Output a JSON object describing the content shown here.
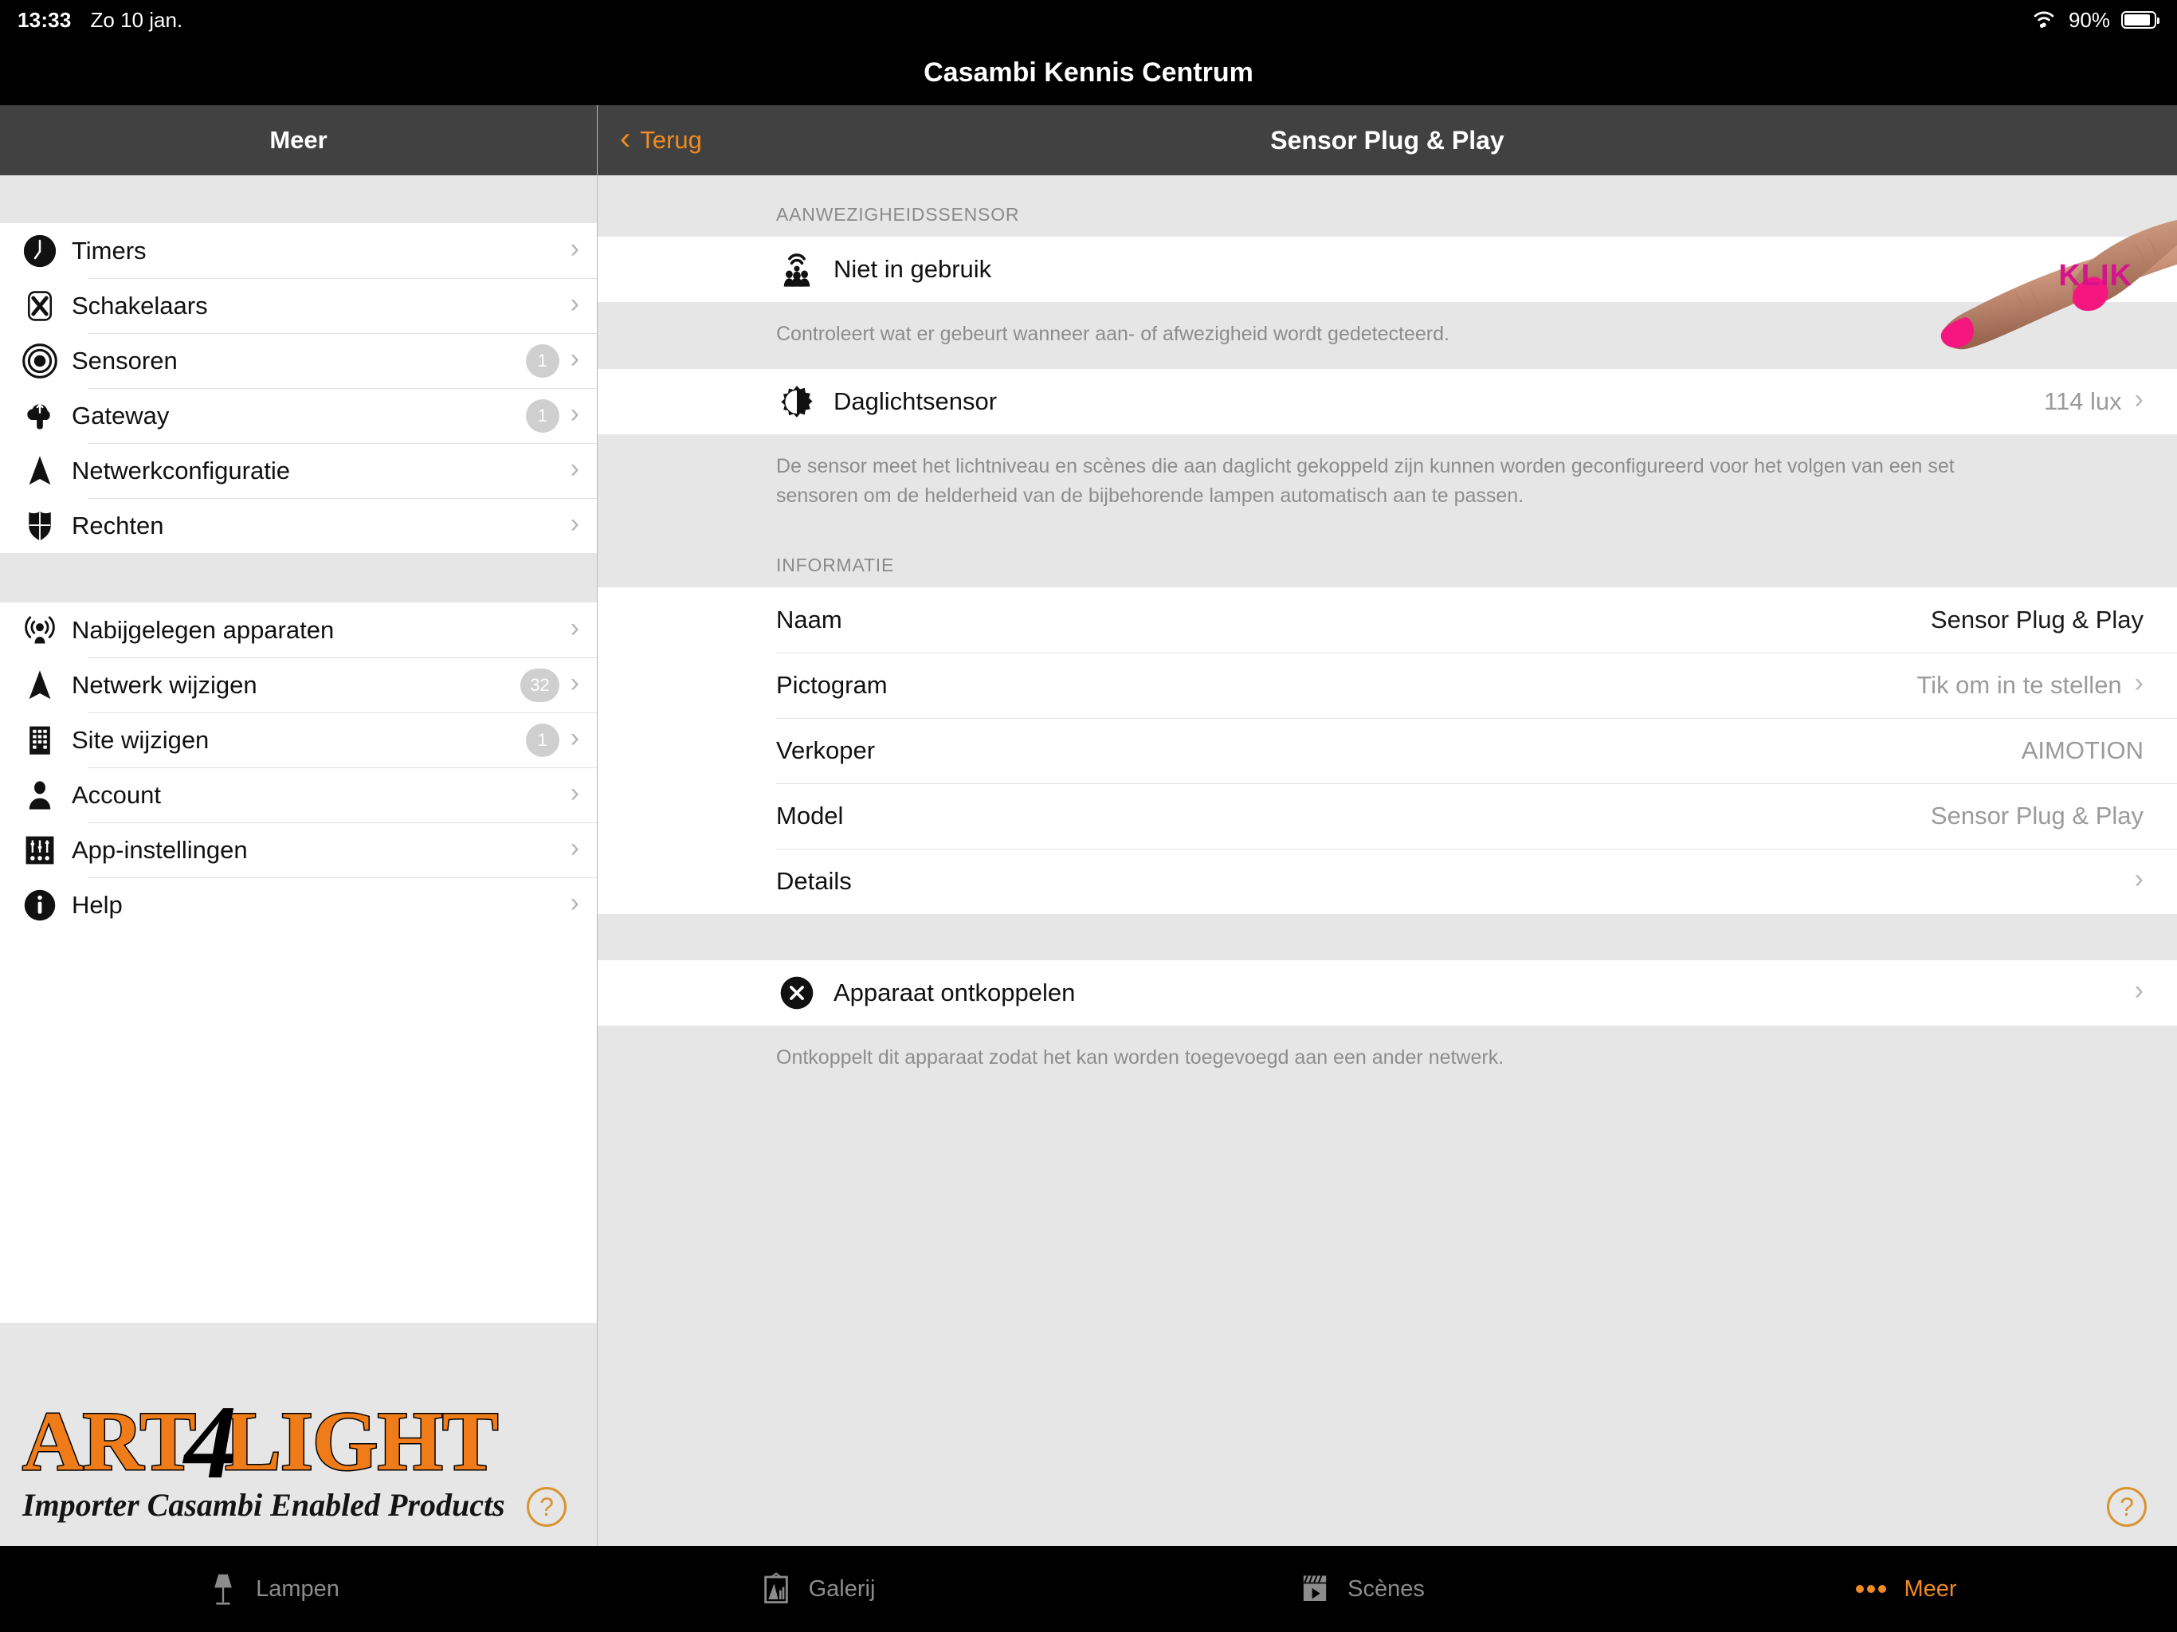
{
  "status_bar": {
    "time": "13:33",
    "date": "Zo 10 jan.",
    "battery_percent": "90%",
    "wifi_icon": "wifi-icon",
    "battery_icon": "battery-icon"
  },
  "app_title": "Casambi Kennis Centrum",
  "left_pane": {
    "navbar_title": "Meer",
    "group1": [
      {
        "label": "Timers",
        "icon": "clock-icon",
        "badge": null
      },
      {
        "label": "Schakelaars",
        "icon": "switch-icon",
        "badge": null
      },
      {
        "label": "Sensoren",
        "icon": "sensor-icon",
        "badge": "1"
      },
      {
        "label": "Gateway",
        "icon": "gateway-cloud-icon",
        "badge": "1"
      },
      {
        "label": "Netwerkconfiguratie",
        "icon": "network-icon",
        "badge": null
      },
      {
        "label": "Rechten",
        "icon": "shield-icon",
        "badge": null
      }
    ],
    "group2": [
      {
        "label": "Nabijgelegen apparaten",
        "icon": "nearby-devices-icon",
        "badge": null
      },
      {
        "label": "Netwerk wijzigen",
        "icon": "network-icon",
        "badge": "32"
      },
      {
        "label": "Site wijzigen",
        "icon": "building-icon",
        "badge": "1"
      },
      {
        "label": "Account",
        "icon": "person-icon",
        "badge": null
      },
      {
        "label": "App-instellingen",
        "icon": "sliders-icon",
        "badge": null
      },
      {
        "label": "Help",
        "icon": "info-icon",
        "badge": null
      }
    ],
    "help_button": "?"
  },
  "right_pane": {
    "back_label": "Terug",
    "back_icon": "chevron-left-icon",
    "navbar_title": "Sensor Plug & Play",
    "section_presence": {
      "header": "AANWEZIGHEIDSSENSOR",
      "row": {
        "label": "Niet in gebruik",
        "icon": "presence-sensor-icon"
      },
      "description": "Controleert wat er gebeurt wanneer aan- of afwezigheid wordt gedetecteerd."
    },
    "section_daylight": {
      "row": {
        "label": "Daglichtsensor",
        "icon": "daylight-sensor-icon",
        "value": "114 lux"
      },
      "description": "De sensor meet het lichtniveau en scènes die aan daglicht gekoppeld zijn kunnen worden geconfigureerd voor het volgen van een set sensoren om de helderheid van de bijbehorende lampen automatisch aan te passen."
    },
    "section_info": {
      "header": "INFORMATIE",
      "rows": [
        {
          "label": "Naam",
          "value": "Sensor Plug & Play",
          "value_dark": true,
          "chevron": false
        },
        {
          "label": "Pictogram",
          "value": "Tik om in te stellen",
          "value_dark": false,
          "chevron": true
        },
        {
          "label": "Verkoper",
          "value": "AIMOTION",
          "value_dark": false,
          "chevron": false
        },
        {
          "label": "Model",
          "value": "Sensor Plug & Play",
          "value_dark": false,
          "chevron": false
        },
        {
          "label": "Details",
          "value": "",
          "value_dark": false,
          "chevron": true
        }
      ]
    },
    "section_unpair": {
      "row": {
        "label": "Apparaat ontkoppelen",
        "icon": "close-circle-icon"
      },
      "description": "Ontkoppelt dit apparaat zodat het kan worden toegevoegd aan een ander netwerk."
    },
    "help_button": "?"
  },
  "annotation": {
    "klik_label": "KLIK",
    "klik_color": "#d4148c",
    "hand_icon": "pointing-hand-photo"
  },
  "tabbar": [
    {
      "label": "Lampen",
      "icon": "lamp-icon",
      "active": false
    },
    {
      "label": "Galerij",
      "icon": "gallery-icon",
      "active": false
    },
    {
      "label": "Scènes",
      "icon": "clapboard-icon",
      "active": false
    },
    {
      "label": "Meer",
      "icon": "ellipsis-icon",
      "active": true
    }
  ],
  "branding": {
    "logo_part1": "ART",
    "logo_part2": "4",
    "logo_part3": "LIGHT",
    "logo_tagline": "Importer Casambi Enabled Products",
    "logo_color": "#ef7c18"
  },
  "colors": {
    "accent": "#ef8b22",
    "navbar": "#414141",
    "page_bg": "#e6e6e6"
  }
}
